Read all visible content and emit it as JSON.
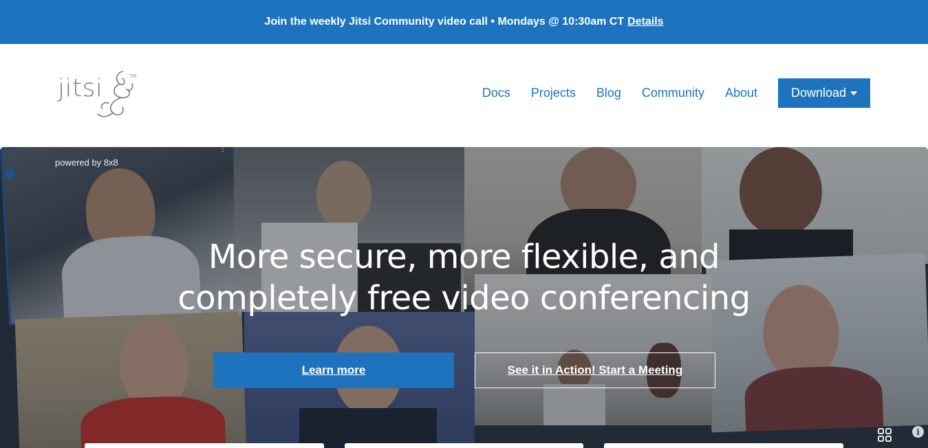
{
  "announcement": {
    "text": "Join the weekly Jitsi Community video call • Mondays @ 10:30am CT",
    "link_label": "Details"
  },
  "logo": {
    "text": "jitsi",
    "tm": "TM"
  },
  "nav": {
    "links": [
      "Docs",
      "Projects",
      "Blog",
      "Community",
      "About"
    ],
    "download_label": "Download"
  },
  "hero": {
    "powered_by": "powered by 8x8",
    "title_line1": "More secure, more flexible, and",
    "title_line2": "completely free video conferencing",
    "learn_more_label": "Learn more",
    "start_meeting_label": "See it in Action! Start a Meeting",
    "info_symbol": "i"
  },
  "colors": {
    "brand_blue": "#1e73be",
    "hero_background": "#2a3240"
  },
  "icons": [
    "jitsi-logo-icon",
    "caret-down-icon",
    "grid-view-icon",
    "info-icon",
    "tile-menu-dots-icon",
    "active-speaker-icon"
  ]
}
